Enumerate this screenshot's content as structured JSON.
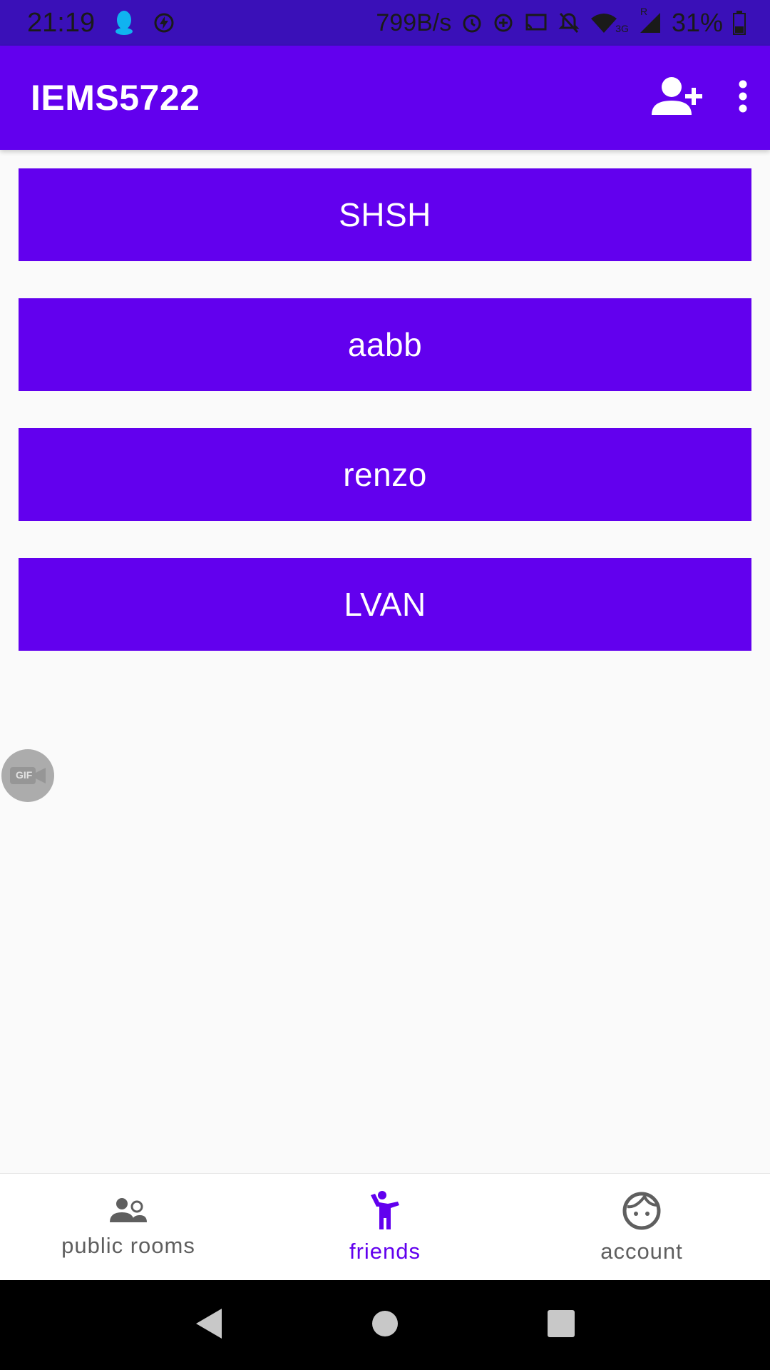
{
  "status_bar": {
    "time": "21:19",
    "network_speed": "799B/s",
    "battery_percent": "31%",
    "signal_label": "3G",
    "roaming_label": "R",
    "icons": [
      "qq-icon",
      "charging-bolt-icon",
      "alarm-icon",
      "data-saver-icon",
      "cast-icon",
      "notifications-off-icon",
      "wifi-icon",
      "signal-icon",
      "battery-icon"
    ]
  },
  "app_bar": {
    "title": "IEMS5722",
    "actions": [
      {
        "name": "add-friend-button",
        "icon": "person-add-icon"
      },
      {
        "name": "overflow-menu-button",
        "icon": "more-vert-icon"
      }
    ]
  },
  "friends": [
    {
      "label": "SHSH"
    },
    {
      "label": "aabb"
    },
    {
      "label": "renzo"
    },
    {
      "label": "LVAN"
    }
  ],
  "floating_bubble": {
    "label": "GIF",
    "icon": "gif-video-icon"
  },
  "bottom_nav": {
    "items": [
      {
        "label": "public rooms",
        "icon": "people-icon",
        "active": false
      },
      {
        "label": "friends",
        "icon": "emoji-people-icon",
        "active": true
      },
      {
        "label": "account",
        "icon": "face-icon",
        "active": false
      }
    ]
  },
  "system_nav": {
    "buttons": [
      "back-icon",
      "home-icon",
      "recents-icon"
    ]
  },
  "colors": {
    "primary": "#6200ee",
    "status_bar": "#3a10b8",
    "background": "#fafafa",
    "nav_inactive": "#5f5f5f"
  }
}
